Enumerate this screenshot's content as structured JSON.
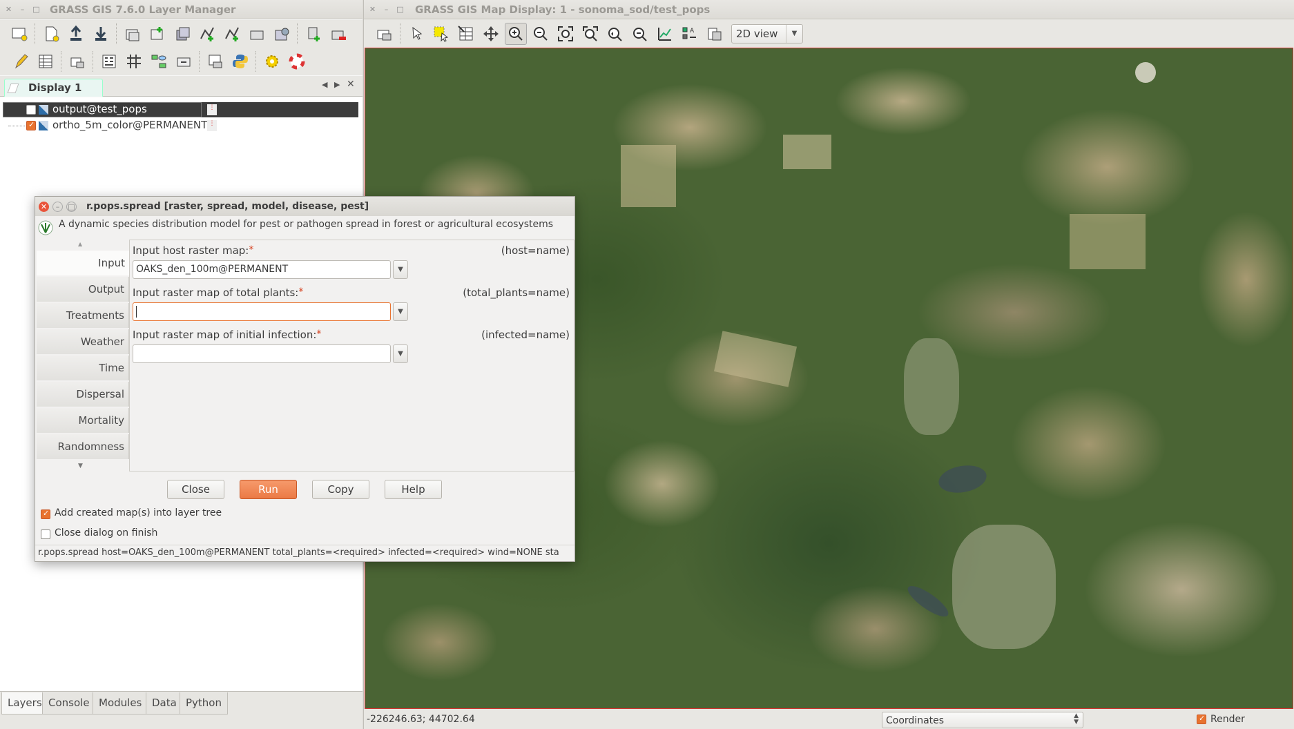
{
  "layer_manager": {
    "title": "GRASS GIS 7.6.0 Layer Manager",
    "display_tab": "Display 1",
    "layers": [
      {
        "name": "output@test_pops",
        "checked": false,
        "selected": true
      },
      {
        "name": "ortho_5m_color@PERMANENT",
        "checked": true,
        "selected": false
      }
    ],
    "bottom_tabs": [
      "Layers",
      "Console",
      "Modules",
      "Data",
      "Python"
    ],
    "active_bottom_tab": "Layers"
  },
  "map_display": {
    "title": "GRASS GIS Map Display: 1 - sonoma_sod/test_pops",
    "view_mode": "2D view",
    "coordinates": "-226246.63; 44702.64",
    "status_select": "Coordinates",
    "render_label": "Render",
    "render_checked": true
  },
  "dialog": {
    "title": "r.pops.spread [raster, spread, model, disease, pest]",
    "description": "A dynamic species distribution model for pest or pathogen spread in forest or agricultural ecosystems",
    "nav_items": [
      "Input",
      "Output",
      "Treatments",
      "Weather",
      "Time",
      "Dispersal",
      "Mortality",
      "Randomness"
    ],
    "active_nav": "Input",
    "fields": [
      {
        "label": "Input host raster map:",
        "param": "(host=name)",
        "value": ""
      },
      {
        "label": "Input raster map of total plants:",
        "param": "(total_plants=name)",
        "value": ""
      },
      {
        "label": "Input raster map of initial infection:",
        "param": "(infected=name)",
        "value": ""
      }
    ],
    "host_value": "OAKS_den_100m@PERMANENT",
    "required_mark": "*",
    "buttons": {
      "close": "Close",
      "run": "Run",
      "copy": "Copy",
      "help": "Help"
    },
    "add_to_tree_label": "Add created map(s) into layer tree",
    "add_to_tree_checked": true,
    "close_on_finish_label": "Close dialog on finish",
    "close_on_finish_checked": false,
    "command": "r.pops.spread host=OAKS_den_100m@PERMANENT total_plants=<required> infected=<required> wind=NONE sta"
  },
  "colors": {
    "accent": "#e8732f",
    "required": "#d53d1a",
    "map_border": "#dd3333"
  }
}
